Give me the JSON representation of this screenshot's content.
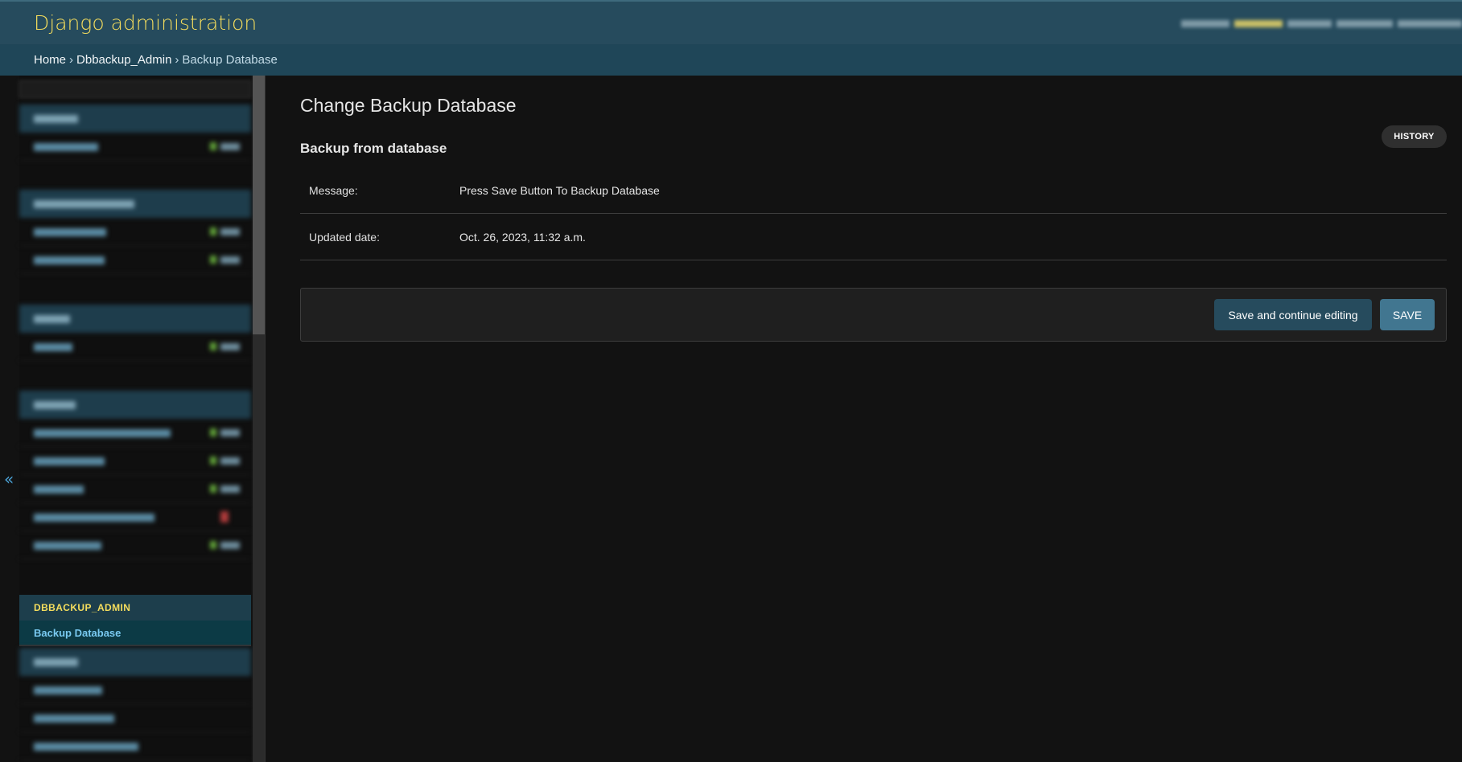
{
  "header": {
    "title": "Django administration"
  },
  "breadcrumbs": {
    "home": "Home",
    "sep1": "›",
    "app": "Dbbackup_Admin",
    "sep2": "›",
    "current": "Backup Database"
  },
  "nav_toggle": {
    "icon": "«"
  },
  "sidebar": {
    "dbbackup_caption": "DBBACKUP_ADMIN",
    "dbbackup_item": "Backup Database"
  },
  "content": {
    "page_title": "Change Backup Database",
    "history_label": "HISTORY",
    "fieldset_title": "Backup from database",
    "fields": [
      {
        "label": "Message:",
        "value": "Press Save Button To Backup Database"
      },
      {
        "label": "Updated date:",
        "value": "Oct. 26, 2023, 11:32 a.m."
      }
    ],
    "buttons": {
      "save_continue": "Save and continue editing",
      "save": "SAVE"
    }
  },
  "colors": {
    "header_bg": "#264b5d",
    "branding": "#f5dd5d",
    "breadcrumbs_bg": "#1f4658",
    "selected_nav_text": "#79c9f0",
    "save_button": "#417690"
  }
}
